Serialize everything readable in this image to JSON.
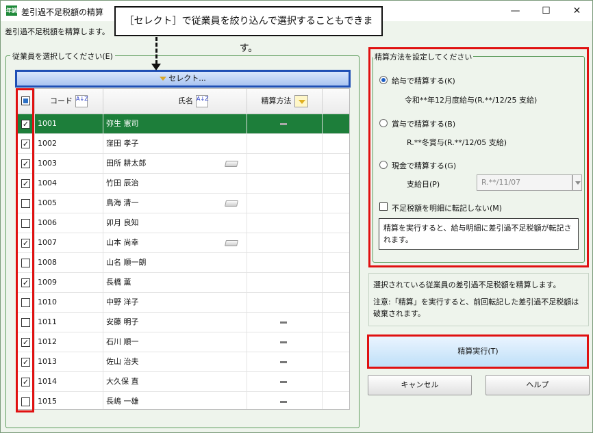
{
  "window": {
    "icon_text": "年調",
    "title": "差引過不足税額の精算",
    "minimize_glyph": "—",
    "maximize_glyph": "☐",
    "close_glyph": "✕"
  },
  "subtitle": "差引過不足税額を精算します。",
  "callout": "［セレクト］で従業員を絞り込んで選択することもできます。",
  "employee_group": {
    "label": "従業員を選択してください(E)",
    "select_button": "セレクト...",
    "columns": {
      "code": "コード",
      "name": "氏名",
      "method": "精算方法"
    },
    "sort_glyph": "A↓Z",
    "rows": [
      {
        "checked": "✓",
        "code": "1001",
        "name": "弥生 憲司",
        "method": "dash",
        "selected": true
      },
      {
        "checked": "✓",
        "code": "1002",
        "name": "窪田 孝子",
        "method": ""
      },
      {
        "checked": "✓",
        "code": "1003",
        "name": "田所 耕太郎",
        "method": "",
        "doc": true
      },
      {
        "checked": "✓",
        "code": "1004",
        "name": "竹田 辰治",
        "method": ""
      },
      {
        "checked": "",
        "code": "1005",
        "name": "鳥海 清一",
        "method": "",
        "doc": true
      },
      {
        "checked": "",
        "code": "1006",
        "name": "卯月 良知",
        "method": ""
      },
      {
        "checked": "✓",
        "code": "1007",
        "name": "山本 尚幸",
        "method": "",
        "doc": true
      },
      {
        "checked": "",
        "code": "1008",
        "name": "山名 順一朗",
        "method": ""
      },
      {
        "checked": "✓",
        "code": "1009",
        "name": "長橋 薫",
        "method": ""
      },
      {
        "checked": "",
        "code": "1010",
        "name": "中野 洋子",
        "method": ""
      },
      {
        "checked": "",
        "code": "1011",
        "name": "安藤 明子",
        "method": "dash"
      },
      {
        "checked": "✓",
        "code": "1012",
        "name": "石川 順一",
        "method": "dash"
      },
      {
        "checked": "✓",
        "code": "1013",
        "name": "佐山 治夫",
        "method": "dash"
      },
      {
        "checked": "✓",
        "code": "1014",
        "name": "大久保 直",
        "method": "dash"
      },
      {
        "checked": "",
        "code": "1015",
        "name": "長嶋 一雄",
        "method": "dash"
      }
    ]
  },
  "method_group": {
    "label": "精算方法を設定してください",
    "salary_option": "給与で精算する(K)",
    "salary_detail": "令和**年12月度給与(R.**/12/25 支給)",
    "bonus_option": "賞与で精算する(B)",
    "bonus_detail": "R.**冬賞与(R.**/12/05 支給)",
    "cash_option": "現金で精算する(G)",
    "payday_label": "支給日(P)",
    "payday_value": "R.**/11/07",
    "no_transfer_label": "不足税額を明細に転記しない(M)",
    "note": "精算を実行すると、給与明細に差引過不足税額が転記されます。"
  },
  "info": {
    "line1": "選択されている従業員の差引過不足税額を精算します。",
    "line2": "注意:「精算」を実行すると、前回転記した差引過不足税額は破棄されます。"
  },
  "buttons": {
    "execute": "精算実行(T)",
    "cancel": "キャンセル",
    "help": "ヘルプ"
  },
  "colors": {
    "selected_row": "#1d7e3a",
    "highlight_red": "#e01010",
    "select_border": "#1e4fb5"
  }
}
